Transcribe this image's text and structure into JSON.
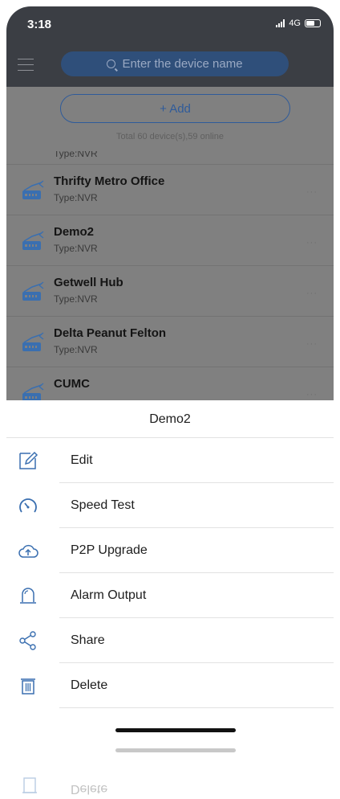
{
  "status_bar": {
    "time": "3:18",
    "network": "4G"
  },
  "header": {
    "search_placeholder": "Enter the device name"
  },
  "add_section": {
    "add_label": "+ Add",
    "total_text": "Total 60 device(s),59 online"
  },
  "devices": {
    "partial_type": "Type:NVR",
    "items": [
      {
        "name": "Thrifty Metro Office",
        "type": "Type:NVR",
        "more": "···"
      },
      {
        "name": "Demo2",
        "type": "Type:NVR",
        "more": "···"
      },
      {
        "name": "Getwell Hub",
        "type": "Type:NVR",
        "more": "···"
      },
      {
        "name": "Delta Peanut Felton",
        "type": "Type:NVR",
        "more": "···"
      },
      {
        "name": "CUMC",
        "type": "",
        "more": "···"
      }
    ]
  },
  "sheet": {
    "title": "Demo2",
    "items": [
      {
        "label": "Edit",
        "icon": "edit-icon"
      },
      {
        "label": "Speed Test",
        "icon": "speedometer-icon"
      },
      {
        "label": "P2P Upgrade",
        "icon": "cloud-upload-icon"
      },
      {
        "label": "Alarm Output",
        "icon": "alarm-light-icon"
      },
      {
        "label": "Share",
        "icon": "share-icon"
      },
      {
        "label": "Delete",
        "icon": "trash-icon"
      }
    ]
  },
  "reflection": {
    "label": "Delete"
  },
  "colors": {
    "accent": "#2f5b9a",
    "icon_blue": "#3a6fb0",
    "header_bg": "#3b3e44",
    "overlay": "#808080"
  }
}
